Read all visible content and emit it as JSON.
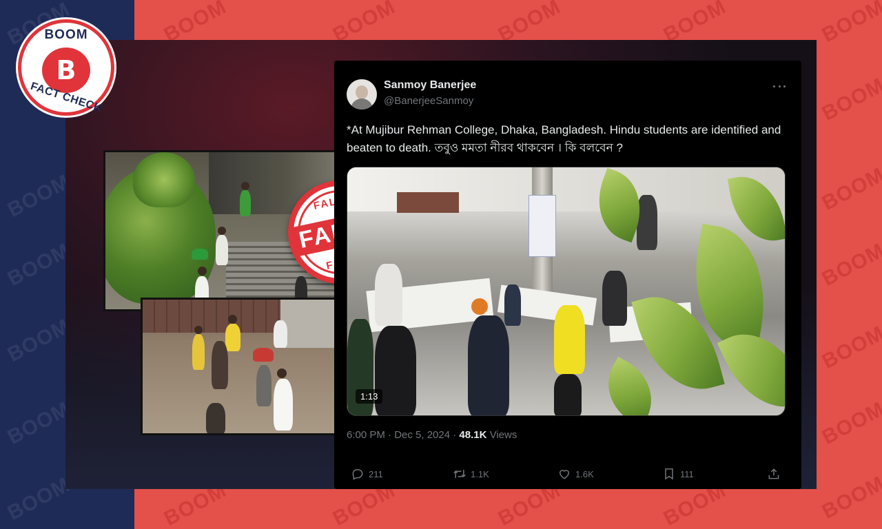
{
  "branding": {
    "logo_top": "BOOM",
    "logo_letter": "B",
    "logo_bottom": "FACT CHECK",
    "watermark": "BOOM",
    "colors": {
      "red": "#e4504a",
      "navy": "#1f2b57",
      "stamp_red": "#e0343a"
    }
  },
  "stamp": {
    "top": "FALSE",
    "center": "FALSE",
    "bottom": "FALSE"
  },
  "tweet": {
    "author_name": "Sanmoy Banerjee",
    "author_handle": "@BanerjeeSanmoy",
    "text": "*At Mujibur Rehman College, Dhaka, Bangladesh. Hindu students are identified and beaten to death. তবুও মমতা নীরব থাকবেন । কি বলবেন ?",
    "video_duration": "1:13",
    "timestamp": "6:00 PM · Dec 5, 2024 · ",
    "views_count": "48.1K",
    "views_label": " Views",
    "replies": "211",
    "reposts": "1.1K",
    "likes": "1.6K",
    "bookmarks": "111",
    "icons": [
      "reply-icon",
      "repost-icon",
      "like-icon",
      "bookmark-icon",
      "share-icon",
      "more-icon"
    ]
  }
}
